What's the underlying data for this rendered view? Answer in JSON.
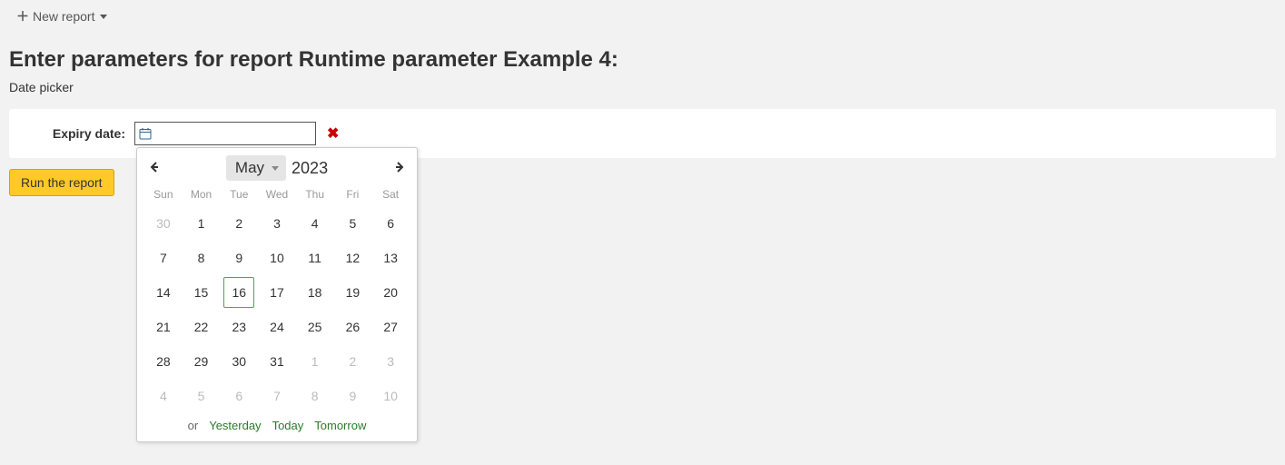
{
  "toolbar": {
    "new_report_label": "New report"
  },
  "page": {
    "title": "Enter parameters for report Runtime parameter Example 4:",
    "subtitle": "Date picker"
  },
  "param": {
    "expiry_label": "Expiry date:",
    "expiry_value": "",
    "expiry_placeholder": ""
  },
  "run_button": "Run the report",
  "calendar": {
    "month": "May",
    "year": "2023",
    "dow": [
      "Sun",
      "Mon",
      "Tue",
      "Wed",
      "Thu",
      "Fri",
      "Sat"
    ],
    "today_index": [
      2,
      2
    ],
    "weeks": [
      [
        {
          "n": "30",
          "other": true
        },
        {
          "n": "1"
        },
        {
          "n": "2"
        },
        {
          "n": "3"
        },
        {
          "n": "4"
        },
        {
          "n": "5"
        },
        {
          "n": "6"
        }
      ],
      [
        {
          "n": "7"
        },
        {
          "n": "8"
        },
        {
          "n": "9"
        },
        {
          "n": "10"
        },
        {
          "n": "11"
        },
        {
          "n": "12"
        },
        {
          "n": "13"
        }
      ],
      [
        {
          "n": "14"
        },
        {
          "n": "15"
        },
        {
          "n": "16",
          "today": true
        },
        {
          "n": "17"
        },
        {
          "n": "18"
        },
        {
          "n": "19"
        },
        {
          "n": "20"
        }
      ],
      [
        {
          "n": "21"
        },
        {
          "n": "22"
        },
        {
          "n": "23"
        },
        {
          "n": "24"
        },
        {
          "n": "25"
        },
        {
          "n": "26"
        },
        {
          "n": "27"
        }
      ],
      [
        {
          "n": "28"
        },
        {
          "n": "29"
        },
        {
          "n": "30"
        },
        {
          "n": "31"
        },
        {
          "n": "1",
          "other": true
        },
        {
          "n": "2",
          "other": true
        },
        {
          "n": "3",
          "other": true
        }
      ],
      [
        {
          "n": "4",
          "other": true
        },
        {
          "n": "5",
          "other": true
        },
        {
          "n": "6",
          "other": true
        },
        {
          "n": "7",
          "other": true
        },
        {
          "n": "8",
          "other": true
        },
        {
          "n": "9",
          "other": true
        },
        {
          "n": "10",
          "other": true
        }
      ]
    ],
    "footer": {
      "or": "or",
      "yesterday": "Yesterday",
      "today": "Today",
      "tomorrow": "Tomorrow"
    }
  }
}
